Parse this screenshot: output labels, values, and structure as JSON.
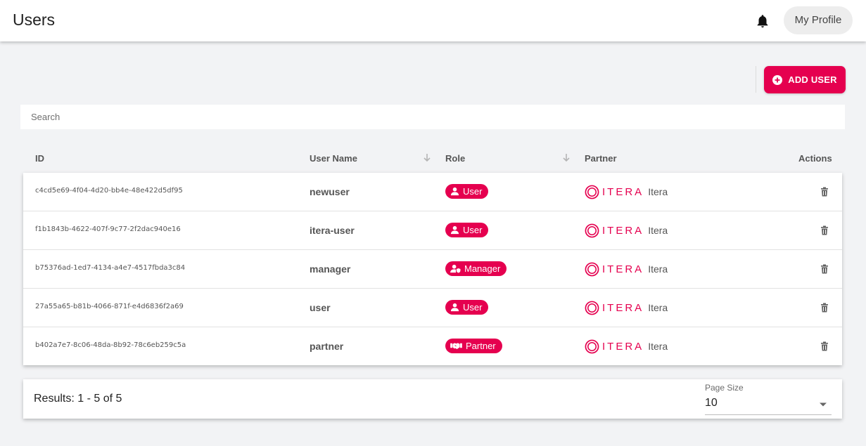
{
  "header": {
    "title": "Users",
    "profile_label": "My Profile"
  },
  "toolbar": {
    "add_user_label": "ADD USER"
  },
  "search": {
    "placeholder": "Search",
    "value": ""
  },
  "table": {
    "columns": {
      "id": "ID",
      "user_name": "User Name",
      "role": "Role",
      "partner": "Partner",
      "actions": "Actions"
    },
    "rows": [
      {
        "id": "c4cd5e69-4f04-4d20-bb4e-48e422d5df95",
        "user_name": "newuser",
        "role": "User",
        "role_icon": "user-icon",
        "partner_logo": "ITERA",
        "partner_name": "Itera"
      },
      {
        "id": "f1b1843b-4622-407f-9c77-2f2dac940e16",
        "user_name": "itera-user",
        "role": "User",
        "role_icon": "user-icon",
        "partner_logo": "ITERA",
        "partner_name": "Itera"
      },
      {
        "id": "b75376ad-1ed7-4134-a4e7-4517fbda3c84",
        "user_name": "manager",
        "role": "Manager",
        "role_icon": "user-shield-icon",
        "partner_logo": "ITERA",
        "partner_name": "Itera"
      },
      {
        "id": "27a55a65-b81b-4066-871f-e4d6836f2a69",
        "user_name": "user",
        "role": "User",
        "role_icon": "user-icon",
        "partner_logo": "ITERA",
        "partner_name": "Itera"
      },
      {
        "id": "b402a7e7-8c06-48da-8b92-78c6eb259c5a",
        "user_name": "partner",
        "role": "Partner",
        "role_icon": "handshake-icon",
        "partner_logo": "ITERA",
        "partner_name": "Itera"
      }
    ]
  },
  "footer": {
    "results_text": "Results: 1 - 5 of 5",
    "page_size_label": "Page Size",
    "page_size_value": "10"
  },
  "colors": {
    "accent": "#e5004f",
    "background": "#f2f3f5"
  }
}
